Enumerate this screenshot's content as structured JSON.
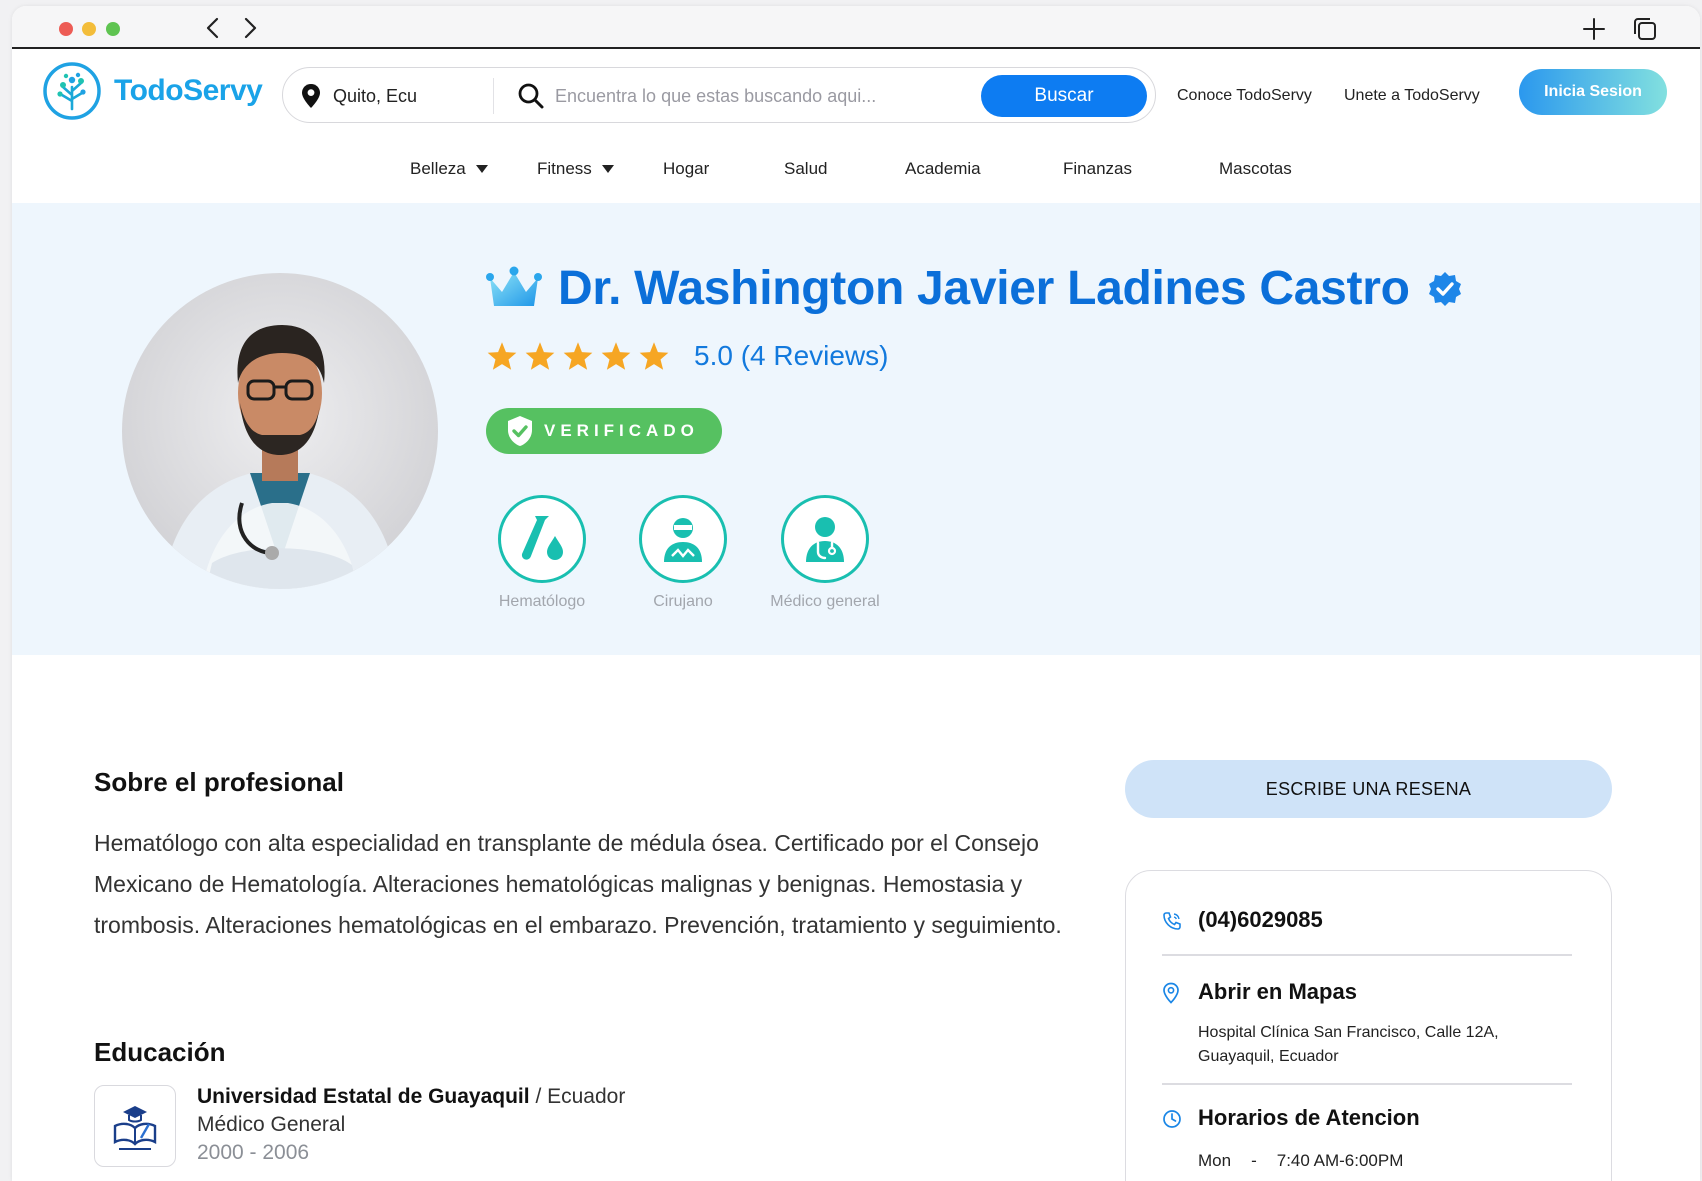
{
  "brand": {
    "name": "TodoServy"
  },
  "search": {
    "location": "Quito, Ecu",
    "placeholder": "Encuentra lo que estas buscando aqui...",
    "button": "Buscar"
  },
  "topnav": {
    "conoce": "Conoce TodoServy",
    "unete": "Unete a TodoServy",
    "login": "Inicia Sesion"
  },
  "categories": [
    "Belleza",
    "Fitness",
    "Hogar",
    "Salud",
    "Academia",
    "Finanzas",
    "Mascotas"
  ],
  "profile": {
    "name": "Dr. Washington Javier Ladines Castro",
    "rating": 5.0,
    "rating_text": "5.0 (4 Reviews)",
    "verified": "VERIFICADO",
    "specialties": [
      "Hematólogo",
      "Cirujano",
      "Médico general"
    ]
  },
  "about": {
    "title": "Sobre el profesional",
    "text": "Hematólogo con alta especialidad en transplante de médula ósea. Certificado por el Consejo Mexicano de Hematología. Alteraciones hematológicas malignas y benignas. Hemostasia y trombosis. Alteraciones hematológicas en el embarazo. Prevención, tratamiento y seguimiento."
  },
  "education": {
    "title": "Educación",
    "items": [
      {
        "university": "Universidad Estatal de Guayaquil",
        "country": "/ Ecuador",
        "degree": "Médico General",
        "years": "2000 - 2006"
      }
    ]
  },
  "review_button": "ESCRIBE UNA RESENA",
  "contact": {
    "phone": "(04)6029085",
    "maps": "Abrir en Mapas",
    "address": "Hospital Clínica San Francisco, Calle 12A, Guayaquil, Ecuador",
    "hours_title": "Horarios de Atencion",
    "hours": [
      {
        "day": "Mon",
        "dash": "-",
        "time": "7:40 AM-6:00PM"
      }
    ]
  },
  "colors": {
    "brand_blue": "#0b6fd9",
    "button_blue": "#0d7cf2",
    "teal": "#19bfb0",
    "verified_green": "#56c161",
    "star": "#f6a623",
    "hero_bg": "#eef6fd"
  }
}
